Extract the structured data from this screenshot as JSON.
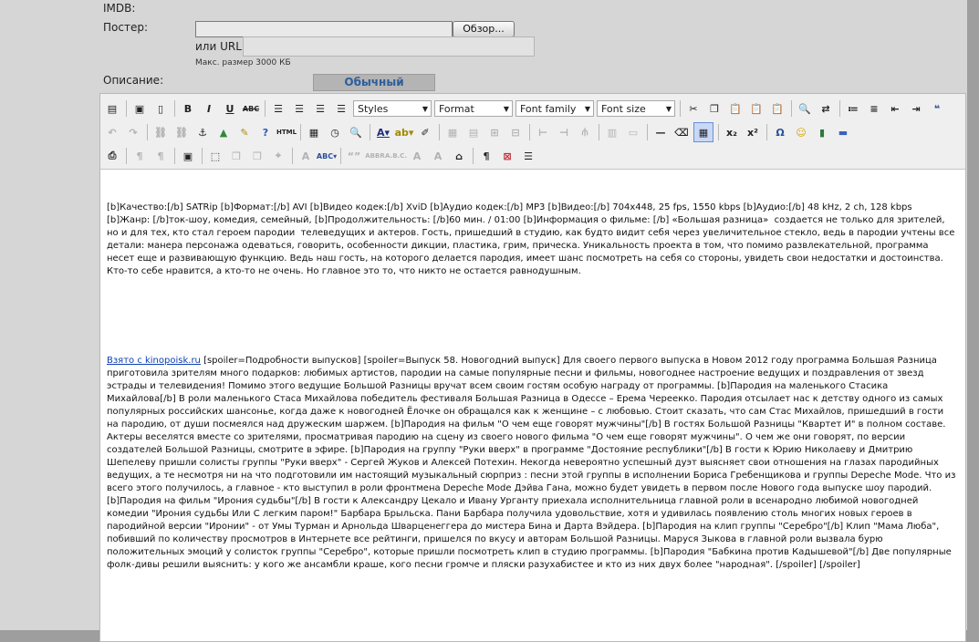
{
  "form": {
    "imdb_label": "IMDB:",
    "poster_label": "Постер:",
    "browse_button": "Обзор...",
    "url_label": "или URL",
    "max_size_text": "Макс. размер 3000 КБ",
    "description_label": "Описание:",
    "plain_editor_button": "Обычный редактор"
  },
  "toolbar": {
    "styles_select": "Styles",
    "format_select": "Format",
    "font_family_select": "Font family",
    "font_size_select": "Font size"
  },
  "content": {
    "paragraph1": "[b]Качество:[/b] SATRip [b]Формат:[/b] AVI [b]Видео кодек:[/b] XviD [b]Аудио кодек:[/b] MP3 [b]Видео:[/b] 704x448, 25 fps, 1550 kbps [b]Аудио:[/b] 48 kHz, 2 ch, 128 kbps [b]Жанр: [/b]ток-шоу, комедия, семейный, [b]Продолжительность: [/b]60 мин. / 01:00 [b]Информация о фильме: [/b] «Большая разница»  создается не только для зрителей, но и для тех, кто стал героем пародии  телеведущих и актеров. Гость, пришедший в студию, как будто видит себя через увеличительное стекло, ведь в пародии учтены все детали: манера персонажа одеваться, говорить, особенности дикции, пластика, грим, прическа. Уникальность проекта в том, что помимо развлекательной, программа несет еще и развивающую функцию. Ведь наш гость, на которого делается пародия, имеет шанс посмотреть на себя со стороны, увидеть свои недостатки и достоинства. Кто-то себе нравится, а кто-то не очень. Но главное это то, что никто не остается равнодушным.",
    "link_text": "Взято с kinopoisk.ru",
    "paragraph2": " [spoiler=Подробности выпусков] [spoiler=Выпуск 58. Новогодний выпуск] Для своего первого выпуска в Новом 2012 году программа Большая Разница приготовила зрителям много подарков: любимых артистов, пародии на самые популярные песни и фильмы, новогоднее настроение ведущих и поздравления от звезд эстрады и телевидения! Помимо этого ведущие Большой Разницы вручат всем своим гостям особую награду от программы. [b]Пародия на маленького Стасика Михайлова[/b] В роли маленького Стаса Михайлова победитель фестиваля Большая Разница в Одессе – Ерема Череекко. Пародия отсылает нас к детству одного из самых популярных российских шансонье, когда даже к новогодней Ёлочке он обращался как к женщине – с любовью. Стоит сказать, что сам Стас Михайлов, пришедший в гости на пародию, от души посмеялся над дружеским шаржем. [b]Пародия на фильм \"О чем еще говорят мужчины\"[/b] В гостях Большой Разницы \"Квартет И\" в полном составе. Актеры веселятся вместе со зрителями, просматривая пародию на сцену из своего нового фильма \"О чем еще говорят мужчины\". О чем же они говорят, по версии создателей Большой Разницы, смотрите в эфире. [b]Пародия на группу \"Руки вверх\" в программе \"Достояние республики\"[/b] В гости к Юрию Николаеву и Дмитрию Шепелеву пришли солисты группы \"Руки вверх\" - Сергей Жуков и Алексей Потехин. Некогда невероятно успешный дуэт выясняет свои отношения на глазах пародийных ведущих, а те несмотря ни на что подготовили им настоящий музыкальный сюрприз : песни этой группы в исполнении Бориса Гребенщикова и группы Depeche Mode. Что из всего этого получилось, а главное - кто выступил в роли фронтмена Depeche Mode Дэйва Гана, можно будет увидеть в первом после Нового года выпуске шоу пародий. [b]Пародия на фильм \"Ирония судьбы\"[/b] В гости к Александру Цекало и Ивану Урганту приехала исполнительница главной роли в всенародно любимой новогодней комедии \"Ирония судьбы Или С легким паром!\" Барбара Брыльска. Пани Барбара получила удовольствие, хотя и удивилась появлению столь многих новых героев в пародийной версии \"Иронии\" - от Умы Турман и Арнольда Шварценеггера до мистера Бина и Дарта Вэйдера. [b]Пародия на клип группы \"Серебро\"[/b] Клип \"Мама Люба\", побивший по количеству просмотров в Интернете все рейтинги, пришелся по вкусу и авторам Большой Разницы. Маруся Зыкова в главной роли вызвала бурю положительных эмоций у солисток группы \"Серебро\", которые пришли посмотреть клип в студию программы. [b]Пародия \"Бабкина против Кадышевой\"[/b] Две популярные фолк-дивы решили выяснить: у кого же ансамбли краше, кого песни громче и пляски разухабистее и кто из них двух более \"народная\". [/spoiler] [/spoiler]"
  },
  "colors": {
    "link": "#0d3fb3",
    "plain_editor_text": "#2d5d9a",
    "form_bg": "#d6d6d6"
  }
}
